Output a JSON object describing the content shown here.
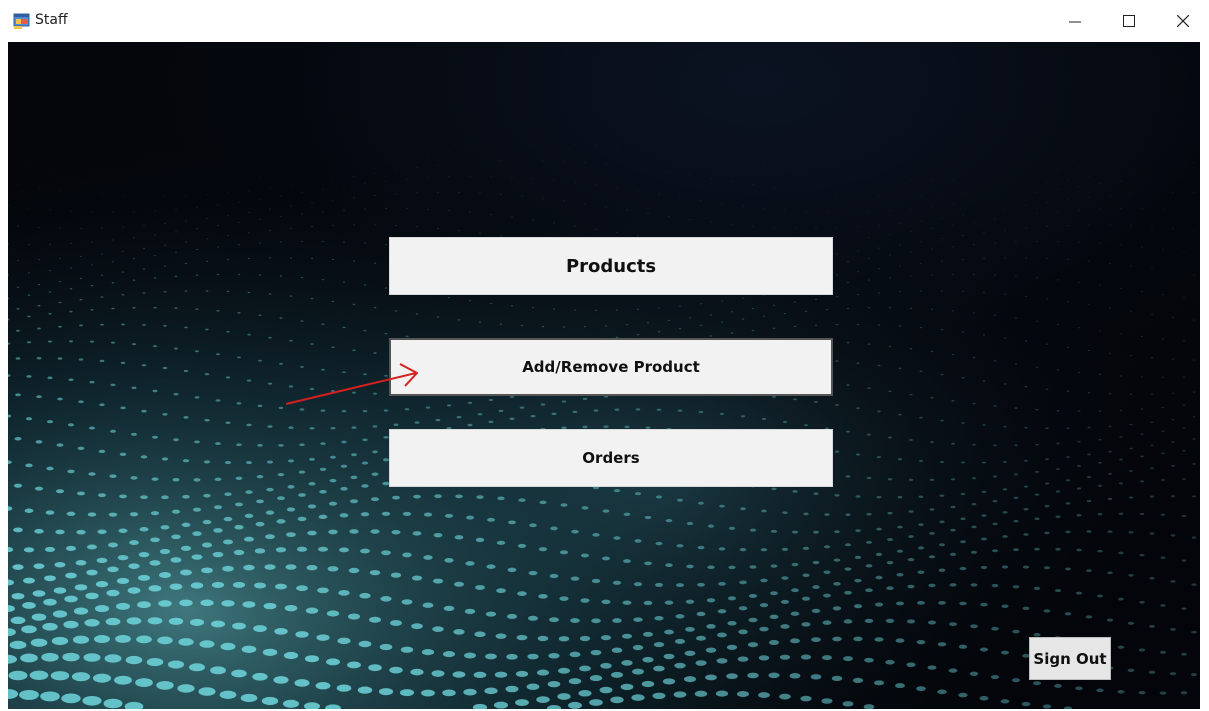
{
  "window": {
    "title": "Staff",
    "icon": "winforms-app-icon",
    "controls": [
      "minimize-icon",
      "maximize-icon",
      "close-icon"
    ]
  },
  "menu": {
    "products_label": "Products",
    "add_remove_label": "Add/Remove Product",
    "orders_label": "Orders"
  },
  "footer": {
    "sign_out_label": "Sign Out"
  },
  "annotation": {
    "arrow_color": "#d62020",
    "points_to": "Add/Remove Product"
  },
  "theme": {
    "background_glow": "#6fd6dc",
    "button_bg": "#f2f2f2"
  }
}
